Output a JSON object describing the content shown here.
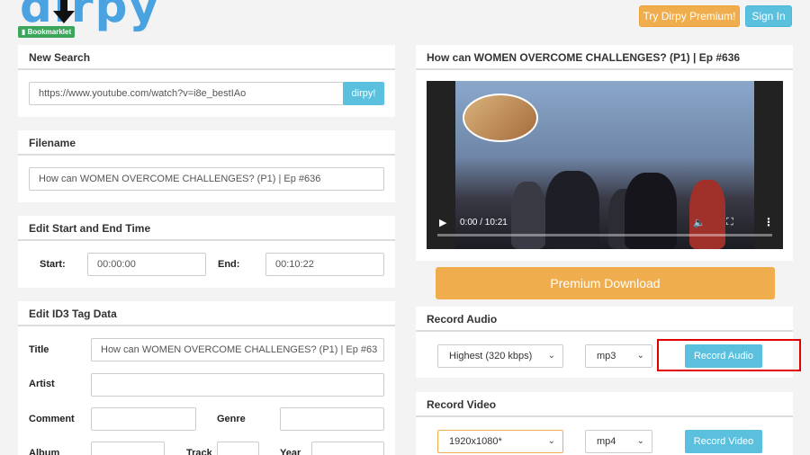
{
  "header": {
    "logo_text": "dirpy",
    "bookmarklet_label": "Bookmarklet",
    "premium_button": "Try Dirpy Premium!",
    "signin_button": "Sign In"
  },
  "new_search": {
    "title": "New Search",
    "url_value": "https://www.youtube.com/watch?v=i8e_bestIAo",
    "go_button": "dirpy!"
  },
  "filename": {
    "title": "Filename",
    "value": "How can WOMEN OVERCOME CHALLENGES? (P1) | Ep #636"
  },
  "time": {
    "title": "Edit Start and End Time",
    "start_label": "Start:",
    "start_value": "00:00:00",
    "end_label": "End:",
    "end_value": "00:10:22"
  },
  "id3": {
    "title": "Edit ID3 Tag Data",
    "title_label": "Title",
    "title_value": "How can WOMEN OVERCOME CHALLENGES? (P1) | Ep #63",
    "artist_label": "Artist",
    "comment_label": "Comment",
    "genre_label": "Genre",
    "album_label": "Album",
    "track_label": "Track",
    "year_label": "Year"
  },
  "video": {
    "title": "How can WOMEN OVERCOME CHALLENGES? (P1) | Ep #636",
    "time_display": "0:00 / 10:21"
  },
  "premium_download": "Premium Download",
  "record_audio": {
    "title": "Record Audio",
    "quality": "Highest (320 kbps)",
    "format": "mp3",
    "button": "Record Audio"
  },
  "record_video": {
    "title": "Record Video",
    "resolution": "1920x1080*",
    "format": "mp4",
    "button": "Record Video"
  },
  "colors": {
    "accent_blue": "#5bc0de",
    "accent_orange": "#f0ad4e",
    "highlight_red": "#e00000"
  }
}
